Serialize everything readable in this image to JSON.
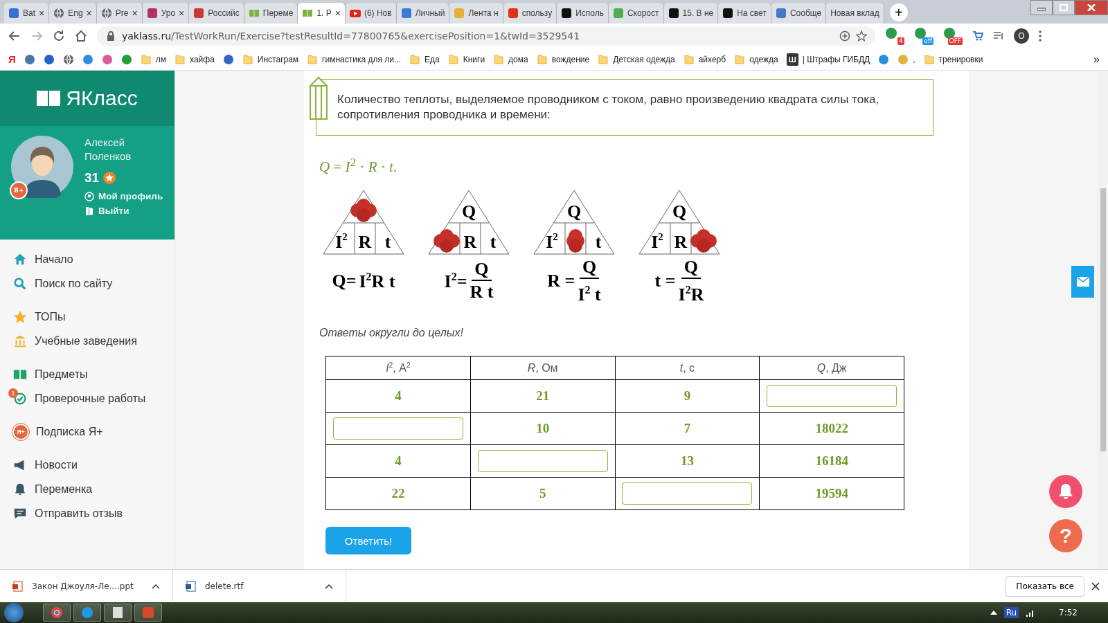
{
  "tabs": [
    {
      "title": "Bat",
      "kind": "tile",
      "color": "#3b6fd8",
      "close": "×",
      "selected": false
    },
    {
      "title": "Eng",
      "kind": "globe",
      "close": "×",
      "selected": false
    },
    {
      "title": "Pre",
      "kind": "globe",
      "close": "×",
      "selected": false
    },
    {
      "title": "Уро",
      "kind": "tile",
      "color": "#b0306a",
      "close": "×",
      "selected": false
    },
    {
      "title": "Российс",
      "kind": "tile",
      "color": "#c83a3a",
      "selected": false
    },
    {
      "title": "Переме",
      "kind": "book",
      "selected": false
    },
    {
      "title": "1. Р",
      "kind": "book",
      "close": "×",
      "selected": true
    },
    {
      "title": "(6) Нов",
      "kind": "play",
      "selected": false
    },
    {
      "title": "Личный",
      "kind": "tile",
      "color": "#3a7bd5",
      "selected": false
    },
    {
      "title": "Лента н",
      "kind": "tile",
      "color": "#e2b23a",
      "selected": false
    },
    {
      "title": "спользу",
      "kind": "tile",
      "color": "#e0301e",
      "selected": false
    },
    {
      "title": "Исполь",
      "kind": "tile",
      "color": "#111111",
      "selected": false
    },
    {
      "title": "Скорост",
      "kind": "tile",
      "color": "#4caf50",
      "selected": false
    },
    {
      "title": "15. В не",
      "kind": "tile",
      "color": "#111111",
      "selected": false
    },
    {
      "title": "На свет",
      "kind": "tile",
      "color": "#111111",
      "selected": false
    },
    {
      "title": "Сообще",
      "kind": "tile",
      "color": "#4a76c9",
      "selected": false
    },
    {
      "title": "Новая вклад",
      "kind": "none",
      "selected": false
    }
  ],
  "new_tab": "+",
  "address_bar": {
    "host": "yaklass.ru",
    "path": "/TestWorkRun/Exercise?testResultId=77800765&exercisePosition=1&twId=3529541"
  },
  "extensions": [
    {
      "badge": "4",
      "color": "#e53935"
    },
    {
      "badge": "off",
      "color": "#2196f3"
    },
    {
      "badge": "OFF",
      "color": "#e53935"
    }
  ],
  "profile_initial": "O",
  "bookmarks": [
    {
      "kind": "letter",
      "glyph": "Я"
    },
    {
      "kind": "tile",
      "color": "#4a76a8"
    },
    {
      "kind": "tile",
      "color": "#1e63c6"
    },
    {
      "kind": "globe"
    },
    {
      "kind": "tile",
      "color": "#2a8fe0"
    },
    {
      "kind": "tile",
      "color": "#e05a9a"
    },
    {
      "kind": "tile",
      "color": "#21a038"
    },
    {
      "kind": "folder",
      "label": "лм"
    },
    {
      "kind": "folder",
      "label": "хайфа"
    },
    {
      "kind": "tile",
      "color": "#3266c8"
    },
    {
      "kind": "folder",
      "label": "Инстаграм"
    },
    {
      "kind": "folder",
      "label": "гимнастика для ли..."
    },
    {
      "kind": "folder",
      "label": "Еда"
    },
    {
      "kind": "folder",
      "label": "Книги"
    },
    {
      "kind": "folder",
      "label": "дома"
    },
    {
      "kind": "folder",
      "label": "вождение"
    },
    {
      "kind": "folder",
      "label": "Детская одежда"
    },
    {
      "kind": "folder",
      "label": "айхерб"
    },
    {
      "kind": "folder",
      "label": "одежда"
    },
    {
      "kind": "letter",
      "glyph": "Ш",
      "label": "| Штрафы ГИБДД"
    },
    {
      "kind": "tile",
      "color": "#2a8fe0"
    },
    {
      "kind": "tile",
      "color": "#e2b23a",
      "label": ","
    },
    {
      "kind": "folder",
      "label": "тренировки"
    }
  ],
  "bookmarks_more": "»",
  "sidebar": {
    "logo": "ЯКласс",
    "user": {
      "name": "Алексей Поленков",
      "points": "31",
      "badge": "Я+",
      "links": [
        {
          "kind": "profile",
          "label": "Мой профиль"
        },
        {
          "kind": "exit",
          "label": "Выйти"
        }
      ]
    },
    "groups": [
      [
        {
          "kind": "home",
          "label": "Начало"
        },
        {
          "kind": "search",
          "label": "Поиск по сайту"
        }
      ],
      [
        {
          "kind": "star",
          "label": "ТОПы"
        },
        {
          "kind": "bank",
          "label": "Учебные заведения"
        }
      ],
      [
        {
          "kind": "books",
          "label": "Предметы"
        },
        {
          "kind": "check",
          "label": "Проверочные работы",
          "badge": "1"
        }
      ],
      [
        {
          "kind": "yaplus",
          "label": "Подписка Я+",
          "glyph": "Я+"
        }
      ],
      [
        {
          "kind": "megaphone",
          "label": "Новости"
        },
        {
          "kind": "bell",
          "label": "Переменка"
        },
        {
          "kind": "comment",
          "label": "Отправить отзыв"
        }
      ]
    ]
  },
  "note": "Количество теплоты, выделяемое проводником с током, равно произведению квадрата силы тока, сопротивления проводника и времени:",
  "formula": "*Q* = *I*$^{2}$ · *R* · *t*.",
  "diagrams": [
    {
      "top": {
        "hidden": true
      },
      "cells": [
        {
          "text": "I",
          "sup": "2",
          "hidden": false
        },
        {
          "text": "R",
          "hidden": false
        },
        {
          "text": "t",
          "hidden": false
        }
      ],
      "lhs": "Q=",
      "expr": "I$^{2}$R t"
    },
    {
      "top": {
        "text": "Q",
        "hidden": false
      },
      "cells": [
        {
          "hidden": true
        },
        {
          "text": "R",
          "hidden": false
        },
        {
          "text": "t",
          "hidden": false
        }
      ],
      "lhs": "I$^{2}$=",
      "numerator": "Q",
      "denominator": "R t"
    },
    {
      "top": {
        "text": "Q",
        "hidden": false
      },
      "cells": [
        {
          "text": "I",
          "sup": "2",
          "hidden": false
        },
        {
          "hidden": true
        },
        {
          "text": "t",
          "hidden": false
        }
      ],
      "lhs": "R =",
      "numerator": "Q",
      "denominator": "I$^{2}$ t"
    },
    {
      "top": {
        "text": "Q",
        "hidden": false
      },
      "cells": [
        {
          "text": "I",
          "sup": "2",
          "hidden": false
        },
        {
          "text": "R",
          "hidden": false
        },
        {
          "hidden": true
        }
      ],
      "lhs": "t =",
      "numerator": "Q",
      "denominator": "I$^{2}$R"
    }
  ],
  "hint": "Ответы округли до целых!",
  "table": {
    "columns": [
      "*I*$^{2}$, А$^{2}$",
      "*R*, Ом",
      "*t*, с",
      "*Q*, Дж"
    ],
    "rows": [
      [
        {
          "kind": "value",
          "text": "4"
        },
        {
          "kind": "value",
          "text": "21"
        },
        {
          "kind": "value",
          "text": "9"
        },
        {
          "kind": "input"
        }
      ],
      [
        {
          "kind": "input"
        },
        {
          "kind": "value",
          "text": "10"
        },
        {
          "kind": "value",
          "text": "7"
        },
        {
          "kind": "value",
          "text": "18022"
        }
      ],
      [
        {
          "kind": "value",
          "text": "4"
        },
        {
          "kind": "input"
        },
        {
          "kind": "value",
          "text": "13"
        },
        {
          "kind": "value",
          "text": "16184"
        }
      ],
      [
        {
          "kind": "value",
          "text": "22"
        },
        {
          "kind": "value",
          "text": "5"
        },
        {
          "kind": "input"
        },
        {
          "kind": "value",
          "text": "19594"
        }
      ]
    ]
  },
  "submit": "Ответить!",
  "help": "?",
  "downloads": [
    {
      "kind": "ppt",
      "name": "Закон Джоуля-Ле....ppt"
    },
    {
      "kind": "doc",
      "name": "delete.rtf"
    }
  ],
  "show_all": "Показать все",
  "taskbar": {
    "language": "Ru",
    "time": "7:52"
  }
}
